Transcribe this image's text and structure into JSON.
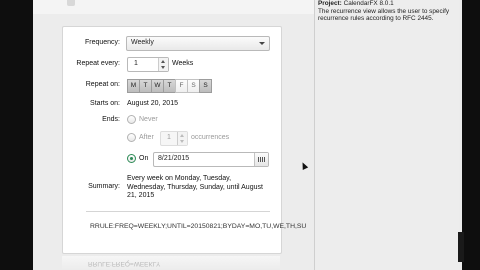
{
  "form": {
    "frequency": {
      "label": "Frequency:",
      "value": "Weekly"
    },
    "repeat_every": {
      "label": "Repeat every:",
      "value": "1",
      "unit": "Weeks"
    },
    "repeat_on": {
      "label": "Repeat on:",
      "days": [
        {
          "label": "M",
          "selected": true
        },
        {
          "label": "T",
          "selected": true
        },
        {
          "label": "W",
          "selected": true
        },
        {
          "label": "T",
          "selected": true
        },
        {
          "label": "F",
          "selected": false
        },
        {
          "label": "S",
          "selected": false
        },
        {
          "label": "S",
          "selected": true
        }
      ]
    },
    "starts_on": {
      "label": "Starts on:",
      "value": "August 20, 2015"
    },
    "ends": {
      "label": "Ends:",
      "never": "Never",
      "after": "After",
      "after_value": "1",
      "after_unit": "occurrences",
      "on": "On",
      "on_value": "8/21/2015",
      "selected": "on"
    },
    "summary": {
      "label": "Summary:",
      "text": "Every week on Monday, Tuesday, Wednesday, Thursday, Sunday, until August 21, 2015"
    },
    "rrule": "RRULE:FREQ=WEEKLY;UNTIL=20150821;BYDAY=MO,TU,WE,TH,SU",
    "reflection_text": "RRULE:FREQ=WEEKLY"
  },
  "info_panel": {
    "project_label": "Project:",
    "project_name": "CalendarFX 8.0.1",
    "description": "The recurrence view allows the user to specify recurrence rules according to RFC 2445."
  }
}
